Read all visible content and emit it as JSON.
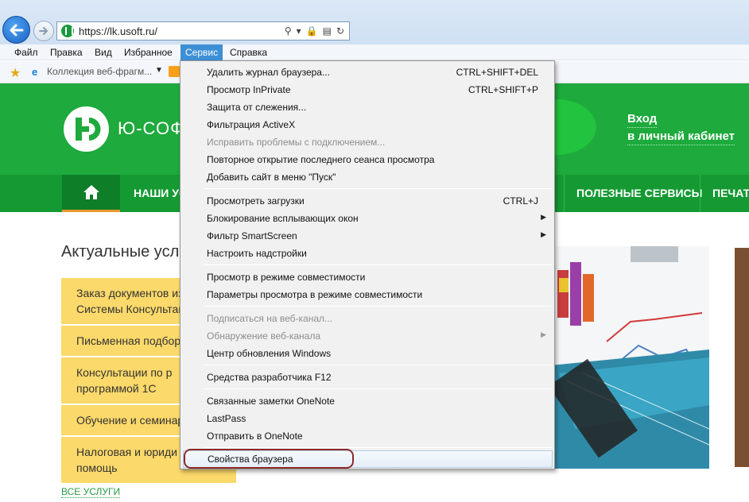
{
  "browser": {
    "url": "https://lk.usoft.ru/",
    "menubar": [
      "Файл",
      "Правка",
      "Вид",
      "Избранное",
      "Сервис",
      "Справка"
    ],
    "active_menu": "Сервис",
    "favorites": {
      "item": "Коллекция веб-фрагм..."
    }
  },
  "site": {
    "logo_text": "Ю-СОФТ",
    "login": [
      "Вход",
      "в личный кабинет"
    ],
    "nav": [
      "НАШИ УС",
      "ПОЛЕЗНЫЕ СЕРВИСЫ",
      "ПЕЧАТ"
    ],
    "section_title": "Актуальные усл",
    "services": [
      [
        "Заказ документов из",
        "Системы Консультан"
      ],
      [
        "Письменная подбор"
      ],
      [
        "Консультации по р",
        "программой 1С"
      ],
      [
        "Обучение и семинар"
      ],
      [
        "Налоговая и юриди",
        "помощь"
      ]
    ],
    "all_services": "ВСЕ УСЛУГИ"
  },
  "dropdown": {
    "items": [
      {
        "label": "Удалить журнал браузера...",
        "shortcut": "CTRL+SHIFT+DEL",
        "enabled": true
      },
      {
        "label": "Просмотр InPrivate",
        "shortcut": "CTRL+SHIFT+P",
        "enabled": true
      },
      {
        "label": "Защита от слежения...",
        "shortcut": "",
        "enabled": true
      },
      {
        "label": "Фильтрация ActiveX",
        "shortcut": "",
        "enabled": true
      },
      {
        "label": "Исправить проблемы с подключением...",
        "shortcut": "",
        "enabled": false
      },
      {
        "label": "Повторное открытие последнего сеанса просмотра",
        "shortcut": "",
        "enabled": true
      },
      {
        "label": "Добавить сайт в меню \"Пуск\"",
        "shortcut": "",
        "enabled": true
      },
      {
        "label": "Просмотреть загрузки",
        "shortcut": "CTRL+J",
        "enabled": true
      },
      {
        "label": "Блокирование всплывающих окон",
        "shortcut": "",
        "enabled": true,
        "submenu": true
      },
      {
        "label": "Фильтр SmartScreen",
        "shortcut": "",
        "enabled": true,
        "submenu": true
      },
      {
        "label": "Настроить надстройки",
        "shortcut": "",
        "enabled": true
      },
      {
        "label": "Просмотр в режиме совместимости",
        "shortcut": "",
        "enabled": true
      },
      {
        "label": "Параметры просмотра в режиме совместимости",
        "shortcut": "",
        "enabled": true
      },
      {
        "label": "Подписаться на веб-канал...",
        "shortcut": "",
        "enabled": false
      },
      {
        "label": "Обнаружение веб-канала",
        "shortcut": "",
        "enabled": false,
        "submenu": true
      },
      {
        "label": "Центр обновления Windows",
        "shortcut": "",
        "enabled": true
      },
      {
        "label": "Средства разработчика F12",
        "shortcut": "",
        "enabled": true
      },
      {
        "label": "Связанные заметки OneNote",
        "shortcut": "",
        "enabled": true
      },
      {
        "label": "LastPass",
        "shortcut": "",
        "enabled": true
      },
      {
        "label": "Отправить в OneNote",
        "shortcut": "",
        "enabled": true
      },
      {
        "label": "Свойства браузера",
        "shortcut": "",
        "enabled": true,
        "highlighted": true
      }
    ]
  },
  "colors": {
    "site_green": "#1eaa3c",
    "nav_green": "#159a33",
    "service_yellow": "#fbd96a",
    "menu_active": "#3d8fd6",
    "highlight_ring": "#8b2a2a"
  }
}
